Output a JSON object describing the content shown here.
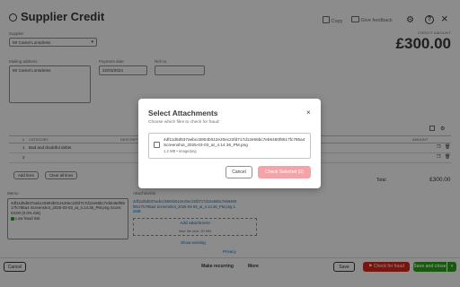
{
  "header": {
    "title": "Supplier Credit",
    "copy_label": "Copy",
    "feedback_label": "Give feedback",
    "help_label": "?",
    "close_label": "×"
  },
  "form": {
    "supplier_label": "Supplier",
    "supplier_value": "Mr Camel Lonsdress",
    "mailing_label": "Mailing address",
    "mailing_value": "Mr Camel Lonsdress",
    "payment_date_label": "Payment date",
    "payment_date_value": "22/03/2024",
    "ref_label": "Ref no.",
    "ref_value": "",
    "credit_amount_label": "CREDIT AMOUNT",
    "credit_amount_value": "£300.00"
  },
  "table": {
    "headers": {
      "num": "#",
      "category": "CATEGORY",
      "description": "DESCRIPTI...",
      "amount": "AMOUNT"
    },
    "rows": [
      {
        "num": "1",
        "category": "Bad and doubtful debts"
      },
      {
        "num": "2",
        "category": ""
      }
    ],
    "add_lines": "Add lines",
    "clear_lines": "Clear all lines",
    "total_label": "Total",
    "total_value": "£300.00"
  },
  "memo": {
    "label": "Memo",
    "text": "4df11d5d537aebcc5904b012e20ec22fd717d12e56bc7eb6460f8617fc785a4 Screenshot_2025-03-03_at_4.14.36_PM.png Score: 0/100 (0.0% risk)",
    "badge": "Low fraud risk"
  },
  "attachments": {
    "label": "Attachments",
    "link": "4df11d5d537aebcc5904b012e20ec22fd717d12e56bc7eb6460f8617fc785a4 Screenshot_2025-03-03_at_4.14.36_PM.png 1.2MB",
    "add_label": "Add attachment",
    "max_label": "Max file size: 20 MB",
    "show_existing": "Show existing",
    "privacy": "Privacy"
  },
  "footer": {
    "cancel": "Cancel",
    "make_recurring": "Make recurring",
    "more": "More",
    "save": "Save",
    "check_fraud": "Check for fraud",
    "save_close": "Save and close"
  },
  "modal": {
    "title": "Select Attachments",
    "subtitle": "Choose which files to check for fraud:",
    "file_name": "4df11d5d537aebcc5904b012e20ec22fd717d12e56bc7eb6460f8617fc785a4 Screenshot_2025-03-03_at_4.14.36_PM.png",
    "file_meta": "1.2 MB • image/png",
    "cancel": "Cancel",
    "check_selected": "Check Selected (0)"
  },
  "colors": {
    "accent_green": "#2ca01c",
    "fraud_red": "#d52b1e",
    "disabled_pink": "#f5a3a8"
  }
}
